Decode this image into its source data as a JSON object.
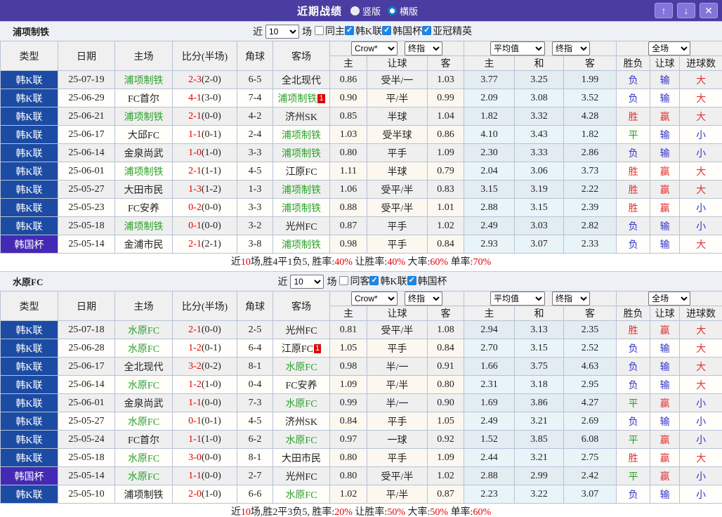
{
  "titlebar": {
    "title": "近期战绩",
    "radios": [
      {
        "label": "竖版",
        "on_c": ""
      },
      {
        "label": "横版",
        "on_c": "on"
      }
    ],
    "buttons": {
      "up": "↑",
      "down": "↓",
      "close": "✕"
    }
  },
  "cols": {
    "main": [
      "类型",
      "日期",
      "主场",
      "比分(半场)",
      "角球",
      "客场"
    ],
    "selects": {
      "book": "Crow*",
      "final1": "终指",
      "avg": "平均值",
      "final2": "终指",
      "scope": "全场"
    },
    "sub": [
      "主",
      "让球",
      "客",
      "主",
      "和",
      "客",
      "胜负",
      "让球",
      "进球数"
    ]
  },
  "sections": [
    {
      "team": "浦项制铁",
      "filter": {
        "near": "近",
        "count": "10",
        "games": "场",
        "checks": [
          {
            "label": "同主",
            "on_c": ""
          },
          {
            "label": "韩K联",
            "on_c": "on"
          },
          {
            "label": "韩国杯",
            "on_c": "on"
          },
          {
            "label": "亚冠精英",
            "on_c": "on"
          }
        ]
      },
      "rows": [
        {
          "type": "韩K联",
          "type_c": "",
          "date": "25-07-19",
          "home": "浦项制铁",
          "home_c": "focus",
          "score": "2-3",
          "half": "(2-0)",
          "corner": "6-5",
          "away": "全北现代",
          "away_c": "",
          "badge": "",
          "h": "0.86",
          "hcp": "受半/一",
          "a": "1.03",
          "m1": "3.77",
          "m2": "3.25",
          "m3": "1.99",
          "r1": "负",
          "r1_c": "blue",
          "r2": "输",
          "r2_c": "blue",
          "r3": "大",
          "r3_c": "red"
        },
        {
          "type": "韩K联",
          "type_c": "",
          "date": "25-06-29",
          "home": "FC首尔",
          "home_c": "",
          "score": "4-1",
          "half": "(3-0)",
          "corner": "7-4",
          "away": "浦项制铁",
          "away_c": "focus",
          "badge": "1",
          "h": "0.90",
          "hcp": "平/半",
          "a": "0.99",
          "m1": "2.09",
          "m2": "3.08",
          "m3": "3.52",
          "r1": "负",
          "r1_c": "blue",
          "r2": "输",
          "r2_c": "blue",
          "r3": "大",
          "r3_c": "red"
        },
        {
          "type": "韩K联",
          "type_c": "",
          "date": "25-06-21",
          "home": "浦项制铁",
          "home_c": "focus",
          "score": "2-1",
          "half": "(0-0)",
          "corner": "4-2",
          "away": "济州SK",
          "away_c": "",
          "badge": "",
          "h": "0.85",
          "hcp": "半球",
          "a": "1.04",
          "m1": "1.82",
          "m2": "3.32",
          "m3": "4.28",
          "r1": "胜",
          "r1_c": "red",
          "r2": "赢",
          "r2_c": "red",
          "r3": "大",
          "r3_c": "red"
        },
        {
          "type": "韩K联",
          "type_c": "",
          "date": "25-06-17",
          "home": "大邱FC",
          "home_c": "",
          "score": "1-1",
          "half": "(0-1)",
          "corner": "2-4",
          "away": "浦项制铁",
          "away_c": "focus",
          "badge": "",
          "h": "1.03",
          "hcp": "受半球",
          "a": "0.86",
          "m1": "4.10",
          "m2": "3.43",
          "m3": "1.82",
          "r1": "平",
          "r1_c": "green",
          "r2": "输",
          "r2_c": "blue",
          "r3": "小",
          "r3_c": "blue"
        },
        {
          "type": "韩K联",
          "type_c": "",
          "date": "25-06-14",
          "home": "金泉尚武",
          "home_c": "",
          "score": "1-0",
          "half": "(1-0)",
          "corner": "3-3",
          "away": "浦项制铁",
          "away_c": "focus",
          "badge": "",
          "h": "0.80",
          "hcp": "平手",
          "a": "1.09",
          "m1": "2.30",
          "m2": "3.33",
          "m3": "2.86",
          "r1": "负",
          "r1_c": "blue",
          "r2": "输",
          "r2_c": "blue",
          "r3": "小",
          "r3_c": "blue"
        },
        {
          "type": "韩K联",
          "type_c": "",
          "date": "25-06-01",
          "home": "浦项制铁",
          "home_c": "focus",
          "score": "2-1",
          "half": "(1-1)",
          "corner": "4-5",
          "away": "江原FC",
          "away_c": "",
          "badge": "",
          "h": "1.11",
          "hcp": "半球",
          "a": "0.79",
          "m1": "2.04",
          "m2": "3.06",
          "m3": "3.73",
          "r1": "胜",
          "r1_c": "red",
          "r2": "赢",
          "r2_c": "red",
          "r3": "大",
          "r3_c": "red"
        },
        {
          "type": "韩K联",
          "type_c": "",
          "date": "25-05-27",
          "home": "大田市民",
          "home_c": "",
          "score": "1-3",
          "half": "(1-2)",
          "corner": "1-3",
          "away": "浦项制铁",
          "away_c": "focus",
          "badge": "",
          "h": "1.06",
          "hcp": "受平/半",
          "a": "0.83",
          "m1": "3.15",
          "m2": "3.19",
          "m3": "2.22",
          "r1": "胜",
          "r1_c": "red",
          "r2": "赢",
          "r2_c": "red",
          "r3": "大",
          "r3_c": "red"
        },
        {
          "type": "韩K联",
          "type_c": "",
          "date": "25-05-23",
          "home": "FC安养",
          "home_c": "",
          "score": "0-2",
          "half": "(0-0)",
          "corner": "3-3",
          "away": "浦项制铁",
          "away_c": "focus",
          "badge": "",
          "h": "0.88",
          "hcp": "受平/半",
          "a": "1.01",
          "m1": "2.88",
          "m2": "3.15",
          "m3": "2.39",
          "r1": "胜",
          "r1_c": "red",
          "r2": "赢",
          "r2_c": "red",
          "r3": "小",
          "r3_c": "blue"
        },
        {
          "type": "韩K联",
          "type_c": "",
          "date": "25-05-18",
          "home": "浦项制铁",
          "home_c": "focus",
          "score": "0-1",
          "half": "(0-0)",
          "corner": "3-2",
          "away": "光州FC",
          "away_c": "",
          "badge": "",
          "h": "0.87",
          "hcp": "平手",
          "a": "1.02",
          "m1": "2.49",
          "m2": "3.03",
          "m3": "2.82",
          "r1": "负",
          "r1_c": "blue",
          "r2": "输",
          "r2_c": "blue",
          "r3": "小",
          "r3_c": "blue"
        },
        {
          "type": "韩国杯",
          "type_c": "cup",
          "date": "25-05-14",
          "home": "金浦市民",
          "home_c": "",
          "score": "2-1",
          "half": "(2-1)",
          "corner": "3-8",
          "away": "浦项制铁",
          "away_c": "focus",
          "badge": "",
          "h": "0.98",
          "hcp": "平手",
          "a": "0.84",
          "m1": "2.93",
          "m2": "3.07",
          "m3": "2.33",
          "r1": "负",
          "r1_c": "blue",
          "r2": "输",
          "r2_c": "blue",
          "r3": "大",
          "r3_c": "red"
        }
      ],
      "summary": [
        {
          "t": "近"
        },
        {
          "t": "10",
          "c": "red"
        },
        {
          "t": "场,胜4平1负5, 胜率:"
        },
        {
          "t": "40%",
          "c": "red"
        },
        {
          "t": " 让胜率:"
        },
        {
          "t": "40%",
          "c": "red"
        },
        {
          "t": " 大率:"
        },
        {
          "t": "60%",
          "c": "red"
        },
        {
          "t": " 单率:"
        },
        {
          "t": "70%",
          "c": "red"
        }
      ]
    },
    {
      "team": "水原FC",
      "filter": {
        "near": "近",
        "count": "10",
        "games": "场",
        "checks": [
          {
            "label": "同客",
            "on_c": ""
          },
          {
            "label": "韩K联",
            "on_c": "on"
          },
          {
            "label": "韩国杯",
            "on_c": "on"
          }
        ]
      },
      "rows": [
        {
          "type": "韩K联",
          "type_c": "",
          "date": "25-07-18",
          "home": "水原FC",
          "home_c": "focus",
          "score": "2-1",
          "half": "(0-0)",
          "corner": "2-5",
          "away": "光州FC",
          "away_c": "",
          "badge": "",
          "h": "0.81",
          "hcp": "受平/半",
          "a": "1.08",
          "m1": "2.94",
          "m2": "3.13",
          "m3": "2.35",
          "r1": "胜",
          "r1_c": "red",
          "r2": "赢",
          "r2_c": "red",
          "r3": "大",
          "r3_c": "red"
        },
        {
          "type": "韩K联",
          "type_c": "",
          "date": "25-06-28",
          "home": "水原FC",
          "home_c": "focus",
          "score": "1-2",
          "half": "(0-1)",
          "corner": "6-4",
          "away": "江原FC",
          "away_c": "",
          "badge": "1",
          "h": "1.05",
          "hcp": "平手",
          "a": "0.84",
          "m1": "2.70",
          "m2": "3.15",
          "m3": "2.52",
          "r1": "负",
          "r1_c": "blue",
          "r2": "输",
          "r2_c": "blue",
          "r3": "大",
          "r3_c": "red"
        },
        {
          "type": "韩K联",
          "type_c": "",
          "date": "25-06-17",
          "home": "全北现代",
          "home_c": "",
          "score": "3-2",
          "half": "(0-2)",
          "corner": "8-1",
          "away": "水原FC",
          "away_c": "focus",
          "badge": "",
          "h": "0.98",
          "hcp": "半/一",
          "a": "0.91",
          "m1": "1.66",
          "m2": "3.75",
          "m3": "4.63",
          "r1": "负",
          "r1_c": "blue",
          "r2": "输",
          "r2_c": "blue",
          "r3": "大",
          "r3_c": "red"
        },
        {
          "type": "韩K联",
          "type_c": "",
          "date": "25-06-14",
          "home": "水原FC",
          "home_c": "focus",
          "score": "1-2",
          "half": "(1-0)",
          "corner": "0-4",
          "away": "FC安养",
          "away_c": "",
          "badge": "",
          "h": "1.09",
          "hcp": "平/半",
          "a": "0.80",
          "m1": "2.31",
          "m2": "3.18",
          "m3": "2.95",
          "r1": "负",
          "r1_c": "blue",
          "r2": "输",
          "r2_c": "blue",
          "r3": "大",
          "r3_c": "red"
        },
        {
          "type": "韩K联",
          "type_c": "",
          "date": "25-06-01",
          "home": "金泉尚武",
          "home_c": "",
          "score": "1-1",
          "half": "(0-0)",
          "corner": "7-3",
          "away": "水原FC",
          "away_c": "focus",
          "badge": "",
          "h": "0.99",
          "hcp": "半/一",
          "a": "0.90",
          "m1": "1.69",
          "m2": "3.86",
          "m3": "4.27",
          "r1": "平",
          "r1_c": "green",
          "r2": "赢",
          "r2_c": "red",
          "r3": "小",
          "r3_c": "blue"
        },
        {
          "type": "韩K联",
          "type_c": "",
          "date": "25-05-27",
          "home": "水原FC",
          "home_c": "focus",
          "score": "0-1",
          "half": "(0-1)",
          "corner": "4-5",
          "away": "济州SK",
          "away_c": "",
          "badge": "",
          "h": "0.84",
          "hcp": "平手",
          "a": "1.05",
          "m1": "2.49",
          "m2": "3.21",
          "m3": "2.69",
          "r1": "负",
          "r1_c": "blue",
          "r2": "输",
          "r2_c": "blue",
          "r3": "小",
          "r3_c": "blue"
        },
        {
          "type": "韩K联",
          "type_c": "",
          "date": "25-05-24",
          "home": "FC首尔",
          "home_c": "",
          "score": "1-1",
          "half": "(1-0)",
          "corner": "6-2",
          "away": "水原FC",
          "away_c": "focus",
          "badge": "",
          "h": "0.97",
          "hcp": "一球",
          "a": "0.92",
          "m1": "1.52",
          "m2": "3.85",
          "m3": "6.08",
          "r1": "平",
          "r1_c": "green",
          "r2": "赢",
          "r2_c": "red",
          "r3": "小",
          "r3_c": "blue"
        },
        {
          "type": "韩K联",
          "type_c": "",
          "date": "25-05-18",
          "home": "水原FC",
          "home_c": "focus",
          "score": "3-0",
          "half": "(0-0)",
          "corner": "8-1",
          "away": "大田市民",
          "away_c": "",
          "badge": "",
          "h": "0.80",
          "hcp": "平手",
          "a": "1.09",
          "m1": "2.44",
          "m2": "3.21",
          "m3": "2.75",
          "r1": "胜",
          "r1_c": "red",
          "r2": "赢",
          "r2_c": "red",
          "r3": "大",
          "r3_c": "red"
        },
        {
          "type": "韩国杯",
          "type_c": "cup",
          "date": "25-05-14",
          "home": "水原FC",
          "home_c": "focus",
          "score": "1-1",
          "half": "(0-0)",
          "corner": "2-7",
          "away": "光州FC",
          "away_c": "",
          "badge": "",
          "h": "0.80",
          "hcp": "受平/半",
          "a": "1.02",
          "m1": "2.88",
          "m2": "2.99",
          "m3": "2.42",
          "r1": "平",
          "r1_c": "green",
          "r2": "赢",
          "r2_c": "red",
          "r3": "小",
          "r3_c": "blue"
        },
        {
          "type": "韩K联",
          "type_c": "",
          "date": "25-05-10",
          "home": "浦项制铁",
          "home_c": "",
          "score": "2-0",
          "half": "(1-0)",
          "corner": "6-6",
          "away": "水原FC",
          "away_c": "focus",
          "badge": "",
          "h": "1.02",
          "hcp": "平/半",
          "a": "0.87",
          "m1": "2.23",
          "m2": "3.22",
          "m3": "3.07",
          "r1": "负",
          "r1_c": "blue",
          "r2": "输",
          "r2_c": "blue",
          "r3": "小",
          "r3_c": "blue"
        }
      ],
      "summary": [
        {
          "t": "近"
        },
        {
          "t": "10",
          "c": "red"
        },
        {
          "t": "场,胜2平3负5, 胜率:"
        },
        {
          "t": "20%",
          "c": "red"
        },
        {
          "t": " 让胜率:"
        },
        {
          "t": "50%",
          "c": "red"
        },
        {
          "t": " 大率:"
        },
        {
          "t": "50%",
          "c": "red"
        },
        {
          "t": " 单率:"
        },
        {
          "t": "60%",
          "c": "red"
        }
      ]
    }
  ]
}
